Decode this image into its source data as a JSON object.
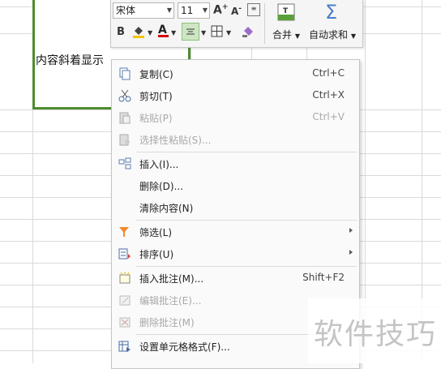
{
  "cell": {
    "text": "内容斜着显示"
  },
  "toolbar": {
    "font_name": "宋体",
    "font_size": "11",
    "grow_font": "A⁺",
    "shrink_font": "A⁻",
    "bold": "B",
    "merge_label": "合并",
    "autosum_label": "自动求和"
  },
  "menu": {
    "items": [
      {
        "label": "复制(C)",
        "shortcut": "Ctrl+C",
        "icon": "copy-icon",
        "enabled": true
      },
      {
        "label": "剪切(T)",
        "shortcut": "Ctrl+X",
        "icon": "scissors-icon",
        "enabled": true
      },
      {
        "label": "粘贴(P)",
        "shortcut": "Ctrl+V",
        "icon": "paste-icon",
        "enabled": false
      },
      {
        "label": "选择性粘贴(S)...",
        "shortcut": "",
        "icon": "paste-special-icon",
        "enabled": false
      },
      {
        "label": "插入(I)...",
        "shortcut": "",
        "icon": "insert-cells-icon",
        "enabled": true
      },
      {
        "label": "删除(D)...",
        "shortcut": "",
        "icon": "",
        "enabled": true
      },
      {
        "label": "清除内容(N)",
        "shortcut": "",
        "icon": "",
        "enabled": true
      },
      {
        "label": "筛选(L)",
        "shortcut": "",
        "icon": "filter-icon",
        "enabled": true
      },
      {
        "label": "排序(U)",
        "shortcut": "",
        "icon": "sort-icon",
        "enabled": true
      },
      {
        "label": "插入批注(M)...",
        "shortcut": "Shift+F2",
        "icon": "comment-icon",
        "enabled": true
      },
      {
        "label": "编辑批注(E)...",
        "shortcut": "",
        "icon": "edit-comment-icon",
        "enabled": false
      },
      {
        "label": "删除批注(M)",
        "shortcut": "",
        "icon": "delete-comment-icon",
        "enabled": false
      },
      {
        "label": "设置单元格格式(F)...",
        "shortcut": "",
        "icon": "format-cells-icon",
        "enabled": true
      }
    ]
  },
  "watermark": "软件技巧"
}
